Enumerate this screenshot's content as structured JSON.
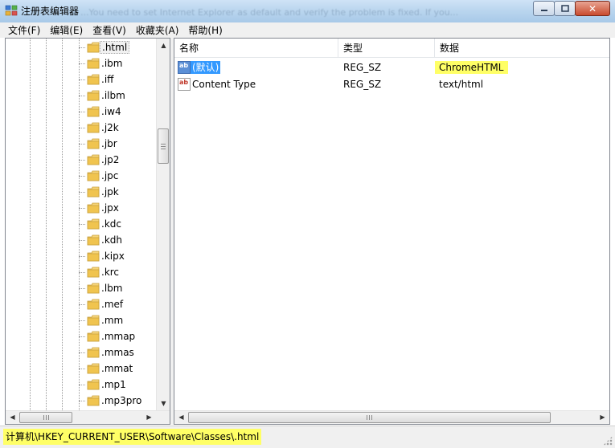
{
  "window": {
    "title": "注册表编辑器",
    "ghost_text": "...You need to set Internet Explorer as default and verify the problem is fixed. If you...",
    "controls": [
      "minimize",
      "maximize",
      "close"
    ]
  },
  "menu": {
    "items": [
      {
        "label": "文件(F)"
      },
      {
        "label": "编辑(E)"
      },
      {
        "label": "查看(V)"
      },
      {
        "label": "收藏夹(A)"
      },
      {
        "label": "帮助(H)"
      }
    ]
  },
  "tree": {
    "selected": ".html",
    "items": [
      {
        "label": ".html"
      },
      {
        "label": ".ibm"
      },
      {
        "label": ".iff"
      },
      {
        "label": ".ilbm"
      },
      {
        "label": ".iw4"
      },
      {
        "label": ".j2k"
      },
      {
        "label": ".jbr"
      },
      {
        "label": ".jp2"
      },
      {
        "label": ".jpc"
      },
      {
        "label": ".jpk"
      },
      {
        "label": ".jpx"
      },
      {
        "label": ".kdc"
      },
      {
        "label": ".kdh"
      },
      {
        "label": ".kipx"
      },
      {
        "label": ".krc"
      },
      {
        "label": ".lbm"
      },
      {
        "label": ".mef"
      },
      {
        "label": ".mm"
      },
      {
        "label": ".mmap"
      },
      {
        "label": ".mmas"
      },
      {
        "label": ".mmat"
      },
      {
        "label": ".mp1"
      },
      {
        "label": ".mp3pro"
      }
    ]
  },
  "list": {
    "columns": {
      "name": "名称",
      "type": "类型",
      "data": "数据"
    },
    "rows": [
      {
        "icon": "string-value-icon",
        "name": "(默认)",
        "type": "REG_SZ",
        "data": "ChromeHTML"
      },
      {
        "icon": "string-value-icon",
        "name": "Content Type",
        "type": "REG_SZ",
        "data": "text/html"
      }
    ]
  },
  "status": {
    "path": "计算机\\HKEY_CURRENT_USER\\Software\\Classes\\.html"
  },
  "colors": {
    "selection": "#3399ff",
    "highlight": "#ffff66",
    "titlebar": "#b9d5ee"
  }
}
